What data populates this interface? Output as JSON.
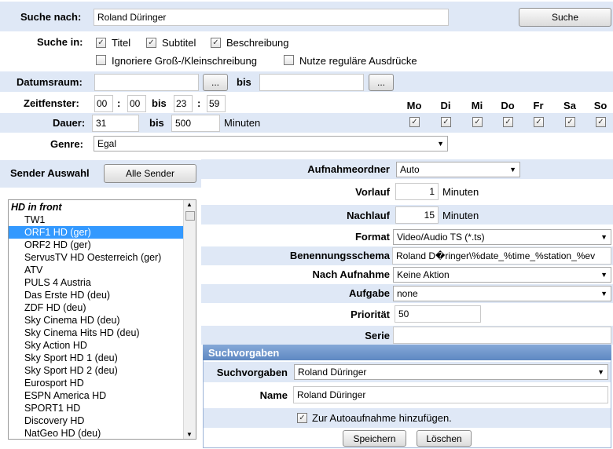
{
  "search": {
    "label": "Suche nach:",
    "value": "Roland Düringer",
    "button": "Suche",
    "in_label": "Suche in:",
    "title_opt": "Titel",
    "subtitle_opt": "Subtitel",
    "desc_opt": "Beschreibung",
    "ignore_case": "Ignoriere Groß-/Kleinschreibung",
    "regex": "Nutze reguläre Ausdrücke"
  },
  "date_range": {
    "label": "Datumsraum:",
    "browse": "...",
    "bis": "bis"
  },
  "time_window": {
    "label": "Zeitfenster:",
    "h1": "00",
    "m1": "00",
    "bis": "bis",
    "h2": "23",
    "m2": "59",
    "sep": ":"
  },
  "duration": {
    "label": "Dauer:",
    "from": "31",
    "bis": "bis",
    "to": "500",
    "unit": "Minuten"
  },
  "days": [
    "Mo",
    "Di",
    "Mi",
    "Do",
    "Fr",
    "Sa",
    "So"
  ],
  "genre": {
    "label": "Genre:",
    "value": "Egal"
  },
  "sender": {
    "label": "Sender Auswahl",
    "all_button": "Alle Sender",
    "items": [
      {
        "label": "HD in front",
        "group": true
      },
      {
        "label": "TW1"
      },
      {
        "label": "ORF1 HD (ger)",
        "selected": true
      },
      {
        "label": "ORF2 HD (ger)"
      },
      {
        "label": "ServusTV HD Oesterreich (ger)"
      },
      {
        "label": "ATV"
      },
      {
        "label": "PULS 4 Austria"
      },
      {
        "label": "Das Erste HD (deu)"
      },
      {
        "label": "ZDF HD (deu)"
      },
      {
        "label": "Sky Cinema HD (deu)"
      },
      {
        "label": "Sky Cinema Hits HD (deu)"
      },
      {
        "label": "Sky Action HD"
      },
      {
        "label": "Sky Sport HD 1 (deu)"
      },
      {
        "label": "Sky Sport HD 2 (deu)"
      },
      {
        "label": "Eurosport HD"
      },
      {
        "label": "ESPN America HD"
      },
      {
        "label": "SPORT1 HD"
      },
      {
        "label": "Discovery HD"
      },
      {
        "label": "NatGeo HD (deu)"
      }
    ]
  },
  "rec": {
    "folder_label": "Aufnahmeordner",
    "folder_value": "Auto",
    "pre_label": "Vorlauf",
    "pre_value": "1",
    "pre_unit": "Minuten",
    "post_label": "Nachlauf",
    "post_value": "15",
    "post_unit": "Minuten",
    "format_label": "Format",
    "format_value": "Video/Audio TS (*.ts)",
    "naming_label": "Benennungsschema",
    "naming_value": "Roland D�ringer\\%date_%time_%station_%ev",
    "after_label": "Nach Aufnahme",
    "after_value": "Keine Aktion",
    "task_label": "Aufgabe",
    "task_value": "none",
    "priority_label": "Priorität",
    "priority_value": "50",
    "series_label": "Serie",
    "series_value": ""
  },
  "presets": {
    "header": "Suchvorgaben",
    "label": "Suchvorgaben",
    "value": "Roland Düringer",
    "name_label": "Name",
    "name_value": "Roland Düringer",
    "auto_label": "Zur Autoaufnahme hinzufügen.",
    "save": "Speichern",
    "delete": "Löschen"
  },
  "colors": {
    "band": "#dfe8f6",
    "header": "#6f97cb",
    "selection": "#3399ff"
  }
}
